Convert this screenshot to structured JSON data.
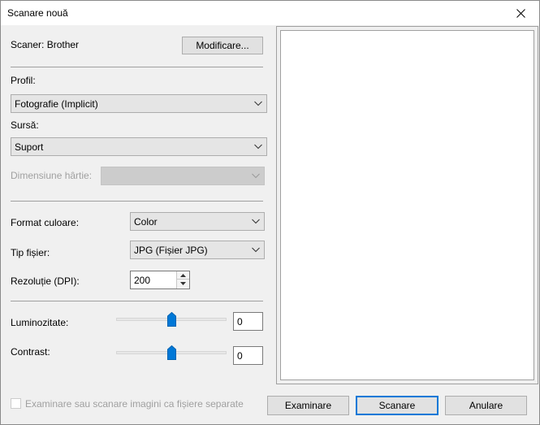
{
  "window": {
    "title": "Scanare nouă"
  },
  "scanner": {
    "label": "Scaner: Brother",
    "change_button": "Modificare..."
  },
  "profile": {
    "label": "Profil:",
    "value": "Fotografie (Implicit)"
  },
  "source": {
    "label": "Sursă:",
    "value": "Suport"
  },
  "paper_size": {
    "label": "Dimensiune hârtie:",
    "value": ""
  },
  "color_format": {
    "label": "Format culoare:",
    "value": "Color"
  },
  "file_type": {
    "label": "Tip fișier:",
    "value": "JPG (Fișier JPG)"
  },
  "resolution": {
    "label": "Rezoluție (DPI):",
    "value": "200"
  },
  "brightness": {
    "label": "Luminozitate:",
    "value": "0",
    "slider_fraction": 0.5
  },
  "contrast": {
    "label": "Contrast:",
    "value": "0",
    "slider_fraction": 0.5
  },
  "separate_files": {
    "label": "Examinare sau scanare imagini ca fișiere separate",
    "checked": false
  },
  "actions": {
    "preview": "Examinare",
    "scan": "Scanare",
    "cancel": "Anulare"
  },
  "icons": {
    "close": "close-icon",
    "dropdown": "chevron-down-icon",
    "spin_up": "spin-up-icon",
    "spin_down": "spin-down-icon",
    "slider": "slider-thumb-icon"
  },
  "colors": {
    "accent": "#0078d7"
  }
}
